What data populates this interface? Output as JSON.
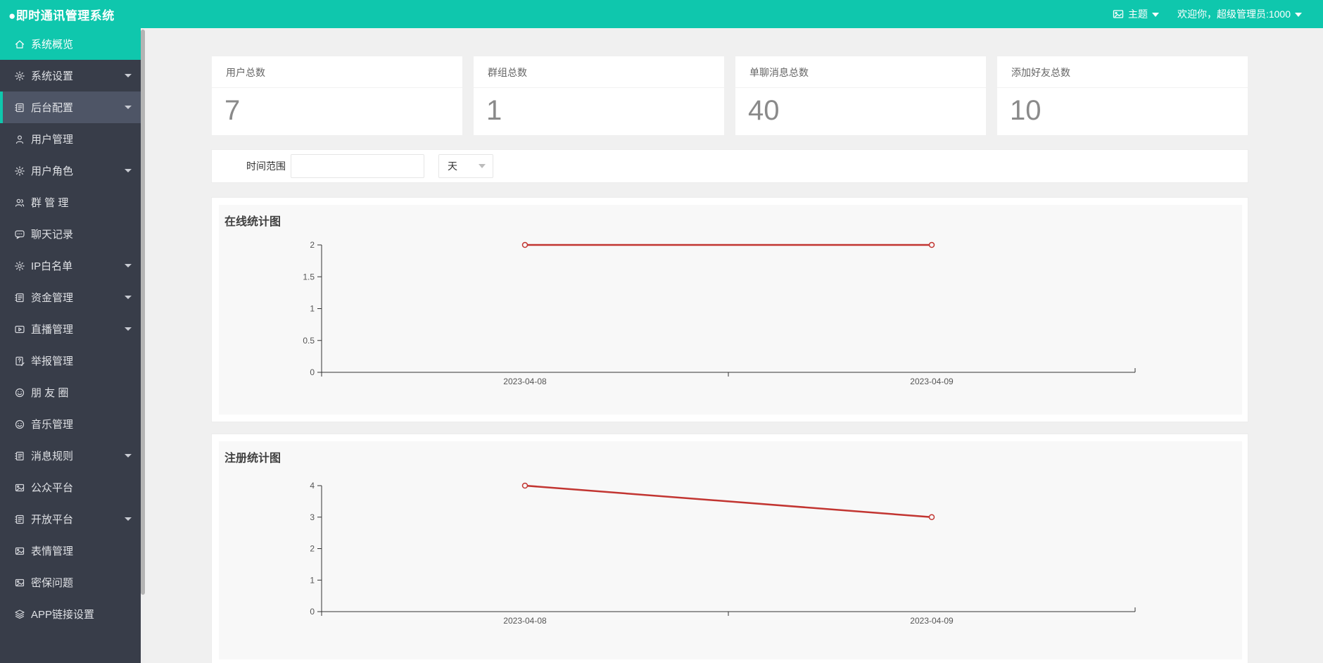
{
  "theme": {
    "accent": "#0fc7ad",
    "sidebar_bg": "#383d49",
    "page_bg": "#f0f0f0"
  },
  "header": {
    "title": "●即时通讯管理系统",
    "theme_label": "主题",
    "welcome": "欢迎你，超级管理员:1000"
  },
  "sidebar": {
    "items": [
      {
        "label": "系统概览",
        "icon": "home-icon",
        "expandable": false,
        "state": "active"
      },
      {
        "label": "系统设置",
        "icon": "gear-icon",
        "expandable": true,
        "state": ""
      },
      {
        "label": "后台配置",
        "icon": "clipboard-icon",
        "expandable": true,
        "state": "selected"
      },
      {
        "label": "用户管理",
        "icon": "user-icon",
        "expandable": false,
        "state": ""
      },
      {
        "label": "用户角色",
        "icon": "gear-icon",
        "expandable": true,
        "state": ""
      },
      {
        "label": "群 管 理",
        "icon": "users-icon",
        "expandable": false,
        "state": ""
      },
      {
        "label": "聊天记录",
        "icon": "chat-icon",
        "expandable": false,
        "state": ""
      },
      {
        "label": "IP白名单",
        "icon": "gear-icon",
        "expandable": true,
        "state": ""
      },
      {
        "label": "资金管理",
        "icon": "clipboard-icon",
        "expandable": true,
        "state": ""
      },
      {
        "label": "直播管理",
        "icon": "video-icon",
        "expandable": true,
        "state": ""
      },
      {
        "label": "举报管理",
        "icon": "report-icon",
        "expandable": false,
        "state": ""
      },
      {
        "label": "朋 友 圈",
        "icon": "smiley-icon",
        "expandable": false,
        "state": ""
      },
      {
        "label": "音乐管理",
        "icon": "smiley-icon",
        "expandable": false,
        "state": ""
      },
      {
        "label": "消息规则",
        "icon": "clipboard-icon",
        "expandable": true,
        "state": ""
      },
      {
        "label": "公众平台",
        "icon": "image-icon",
        "expandable": false,
        "state": ""
      },
      {
        "label": "开放平台",
        "icon": "clipboard-icon",
        "expandable": true,
        "state": ""
      },
      {
        "label": "表情管理",
        "icon": "image-icon",
        "expandable": false,
        "state": ""
      },
      {
        "label": "密保问题",
        "icon": "image-icon",
        "expandable": false,
        "state": ""
      },
      {
        "label": "APP链接设置",
        "icon": "layers-icon",
        "expandable": false,
        "state": ""
      }
    ]
  },
  "stats": [
    {
      "label": "用户总数",
      "value": "7"
    },
    {
      "label": "群组总数",
      "value": "1"
    },
    {
      "label": "单聊消息总数",
      "value": "40"
    },
    {
      "label": "添加好友总数",
      "value": "10"
    }
  ],
  "filter": {
    "label": "时间范围",
    "input_value": "",
    "select_value": "天"
  },
  "chart_data": [
    {
      "type": "line",
      "title": "在线统计图",
      "categories": [
        "2023-04-08",
        "2023-04-09"
      ],
      "series": [
        {
          "values": [
            2,
            2
          ]
        }
      ],
      "yticks": [
        0,
        0.5,
        1,
        1.5,
        2
      ],
      "ylim": [
        0,
        2
      ],
      "xlabel": "",
      "ylabel": "",
      "grid": false,
      "legend": "none",
      "line_color": "#c23531",
      "marker": "open-circle",
      "plot_bg": "#f8f8f8"
    },
    {
      "type": "line",
      "title": "注册统计图",
      "categories": [
        "2023-04-08",
        "2023-04-09"
      ],
      "series": [
        {
          "values": [
            4,
            3
          ]
        }
      ],
      "yticks": [
        0,
        1,
        2,
        3,
        4
      ],
      "ylim": [
        0,
        4
      ],
      "xlabel": "",
      "ylabel": "",
      "grid": false,
      "legend": "none",
      "line_color": "#c23531",
      "marker": "open-circle",
      "plot_bg": "#f8f8f8"
    }
  ]
}
